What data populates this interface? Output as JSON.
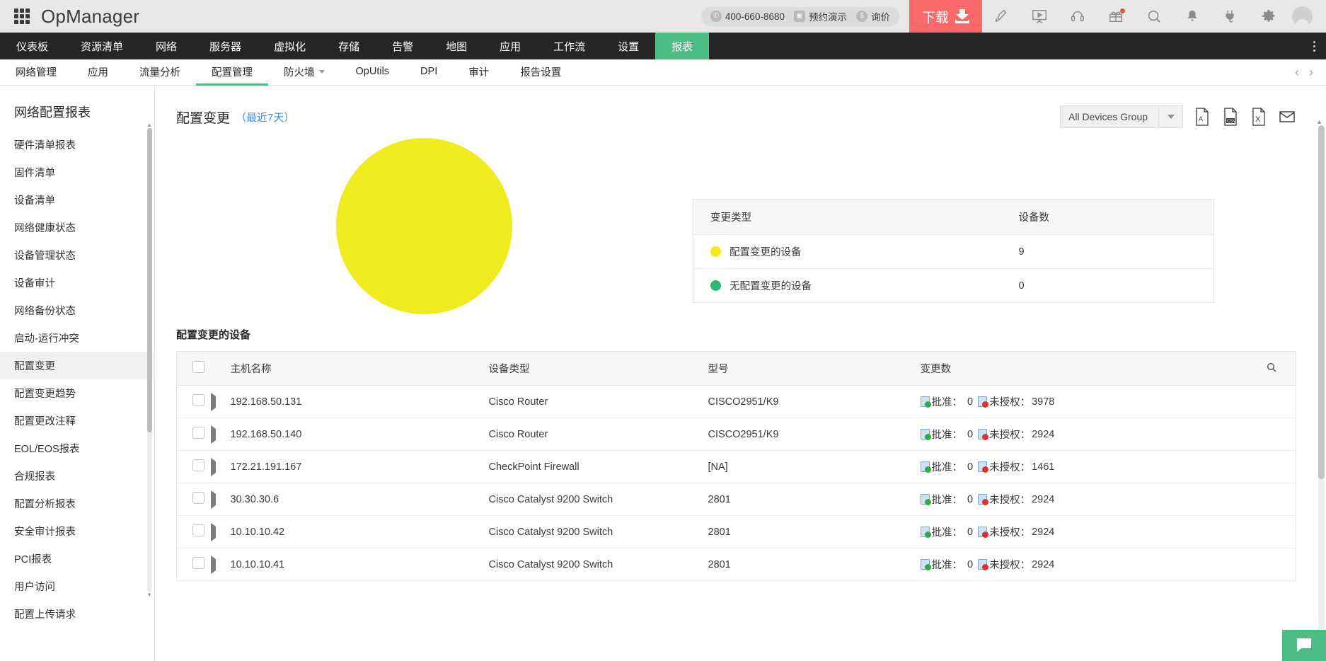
{
  "header": {
    "brand": "OpManager",
    "apps_icon": "grid-apps-icon",
    "contact": {
      "phone": "400-660-8680",
      "phone_icon": "phone-icon",
      "demo_label": "预约演示",
      "demo_icon": "video-icon",
      "price_label": "询价",
      "price_icon": "dollar-icon"
    },
    "download_label": "下载",
    "download_icon": "download-icon",
    "icons": [
      {
        "name": "rocket-icon"
      },
      {
        "name": "presentation-video-icon"
      },
      {
        "name": "headset-support-icon"
      },
      {
        "name": "gift-icon"
      },
      {
        "name": "search-icon"
      },
      {
        "name": "bell-notification-icon"
      },
      {
        "name": "plug-integration-icon"
      },
      {
        "name": "gear-settings-icon"
      },
      {
        "name": "user-avatar-icon"
      }
    ],
    "accent_download_color": "#fa6a6a"
  },
  "mainnav": {
    "items": [
      {
        "label": "仪表板",
        "active": false
      },
      {
        "label": "资源清单",
        "active": false
      },
      {
        "label": "网络",
        "active": false
      },
      {
        "label": "服务器",
        "active": false
      },
      {
        "label": "虚拟化",
        "active": false
      },
      {
        "label": "存储",
        "active": false
      },
      {
        "label": "告警",
        "active": false
      },
      {
        "label": "地图",
        "active": false
      },
      {
        "label": "应用",
        "active": false
      },
      {
        "label": "工作流",
        "active": false
      },
      {
        "label": "设置",
        "active": false
      },
      {
        "label": "报表",
        "active": true
      }
    ],
    "active_color": "#4dbd83",
    "kebab_icon": "more-vertical-icon"
  },
  "subnav": {
    "items": [
      {
        "label": "网络管理",
        "active": false,
        "caret": false
      },
      {
        "label": "应用",
        "active": false,
        "caret": false
      },
      {
        "label": "流量分析",
        "active": false,
        "caret": false
      },
      {
        "label": "配置管理",
        "active": true,
        "caret": false
      },
      {
        "label": "防火墙",
        "active": false,
        "caret": true
      },
      {
        "label": "OpUtils",
        "active": false,
        "caret": false
      },
      {
        "label": "DPI",
        "active": false,
        "caret": false
      },
      {
        "label": "审计",
        "active": false,
        "caret": false
      },
      {
        "label": "报告设置",
        "active": false,
        "caret": false
      }
    ],
    "prev_icon": "chevron-left-icon",
    "next_icon": "chevron-right-icon"
  },
  "sidebar": {
    "title": "网络配置报表",
    "items": [
      {
        "label": "硬件清单报表",
        "active": false
      },
      {
        "label": "固件清单",
        "active": false
      },
      {
        "label": "设备清单",
        "active": false
      },
      {
        "label": "网络健康状态",
        "active": false
      },
      {
        "label": "设备管理状态",
        "active": false
      },
      {
        "label": "设备审计",
        "active": false
      },
      {
        "label": "网络备份状态",
        "active": false
      },
      {
        "label": "启动-运行冲突",
        "active": false
      },
      {
        "label": "配置变更",
        "active": true
      },
      {
        "label": "配置变更趋势",
        "active": false
      },
      {
        "label": "配置更改注释",
        "active": false
      },
      {
        "label": "EOL/EOS报表",
        "active": false
      },
      {
        "label": "合规报表",
        "active": false
      },
      {
        "label": "配置分析报表",
        "active": false
      },
      {
        "label": "安全审计报表",
        "active": false
      },
      {
        "label": "PCI报表",
        "active": false
      },
      {
        "label": "用户访问",
        "active": false
      },
      {
        "label": "配置上传请求",
        "active": false
      }
    ]
  },
  "content": {
    "title": "配置变更",
    "subtitle": "（最近7天）",
    "device_group": {
      "value": "All Devices Group",
      "arrow_icon": "chevron-down-icon"
    },
    "export": [
      {
        "name": "export-pdf-icon",
        "label": "PDF"
      },
      {
        "name": "export-csv-icon",
        "label": "CSV"
      },
      {
        "name": "export-excel-icon",
        "label": "XLS"
      },
      {
        "name": "email-report-icon",
        "label": "Email"
      }
    ],
    "legend_table": {
      "headers": [
        "变更类型",
        "设备数"
      ],
      "rows": [
        {
          "color": "#f0eb1e",
          "label": "配置变更的设备",
          "count": "9"
        },
        {
          "color": "#2eb872",
          "label": "无配置变更的设备",
          "count": "0"
        }
      ]
    },
    "device_table": {
      "caption": "配置变更的设备",
      "headers": [
        "主机名称",
        "设备类型",
        "型号",
        "变更数"
      ],
      "search_icon": "search-icon",
      "approved_label": "批准：",
      "unapproved_label": "未授权：",
      "rows": [
        {
          "host": "192.168.50.131",
          "type": "Cisco Router",
          "model": "CISCO2951/K9",
          "approved": "0",
          "unapproved": "3978"
        },
        {
          "host": "192.168.50.140",
          "type": "Cisco Router",
          "model": "CISCO2951/K9",
          "approved": "0",
          "unapproved": "2924"
        },
        {
          "host": "172.21.191.167",
          "type": "CheckPoint Firewall",
          "model": "[NA]",
          "approved": "0",
          "unapproved": "1461"
        },
        {
          "host": "30.30.30.6",
          "type": "Cisco Catalyst 9200 Switch",
          "model": "2801",
          "approved": "0",
          "unapproved": "2924"
        },
        {
          "host": "10.10.10.42",
          "type": "Cisco Catalyst 9200 Switch",
          "model": "2801",
          "approved": "0",
          "unapproved": "2924"
        },
        {
          "host": "10.10.10.41",
          "type": "Cisco Catalyst 9200 Switch",
          "model": "2801",
          "approved": "0",
          "unapproved": "2924"
        }
      ]
    },
    "chat_icon": "chat-support-icon"
  },
  "chart_data": {
    "type": "pie",
    "title": "配置变更",
    "labels": [
      "配置变更的设备",
      "无配置变更的设备"
    ],
    "values": [
      9,
      0
    ],
    "colors": [
      "#f0eb1e",
      "#2eb872"
    ],
    "legend_position": "right",
    "total": 9
  }
}
